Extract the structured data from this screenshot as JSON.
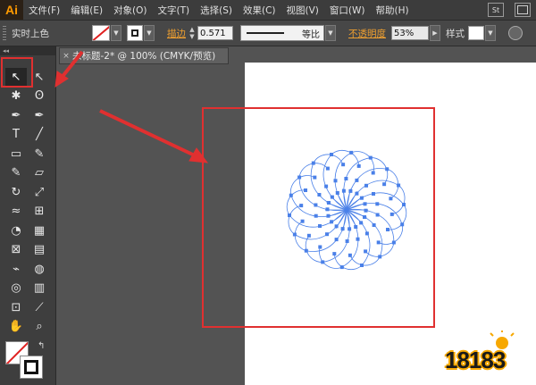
{
  "app": {
    "logo": "Ai"
  },
  "menu": {
    "items": [
      "文件(F)",
      "编辑(E)",
      "对象(O)",
      "文字(T)",
      "选择(S)",
      "效果(C)",
      "视图(V)",
      "窗口(W)",
      "帮助(H)"
    ],
    "right_badge": "St"
  },
  "control_bar": {
    "selection_label": "实时上色",
    "stroke_label": "描边",
    "stroke_value": "0.571",
    "line_style_label": "等比",
    "opacity_label": "不透明度",
    "opacity_value": "53%",
    "style_label": "样式"
  },
  "document": {
    "tab_title": "未标题-2* @ 100% (CMYK/预览)",
    "close": "×"
  },
  "tools": {
    "header": "◂◂",
    "items": [
      "selection-tool",
      "direct-selection-tool",
      "magic-wand-tool",
      "lasso-tool",
      "pen-tool",
      "curvature-tool",
      "type-tool",
      "line-tool",
      "rectangle-tool",
      "paintbrush-tool",
      "pencil-tool",
      "eraser-tool",
      "rotate-tool",
      "scale-tool",
      "warp-tool",
      "free-transform-tool",
      "shape-builder-tool",
      "perspective-grid-tool",
      "mesh-tool",
      "gradient-tool",
      "eyedropper-tool",
      "blend-tool",
      "symbol-sprayer-tool",
      "column-graph-tool",
      "artboard-tool",
      "slice-tool",
      "hand-tool",
      "zoom-tool"
    ]
  },
  "colors": {
    "accent_red": "#e03030",
    "pattern_blue": "#4a80e8",
    "watermark_orange": "#f7a800"
  },
  "watermark": {
    "text": "18183"
  }
}
